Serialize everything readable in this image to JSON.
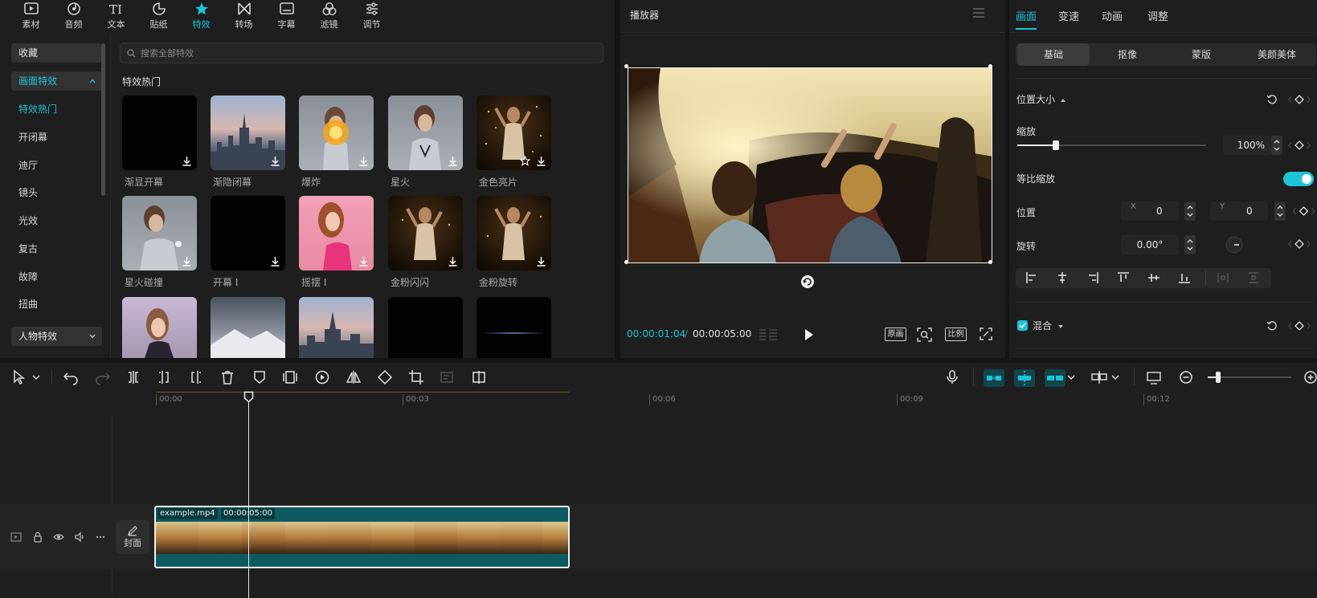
{
  "toolbar": {
    "tabs": [
      {
        "label": "素材",
        "icon": "media-icon",
        "active": false
      },
      {
        "label": "音频",
        "icon": "audio-icon",
        "active": false
      },
      {
        "label": "文本",
        "icon": "text-icon",
        "active": false
      },
      {
        "label": "贴纸",
        "icon": "sticker-icon",
        "active": false
      },
      {
        "label": "特效",
        "icon": "effects-star-icon",
        "active": true
      },
      {
        "label": "转场",
        "icon": "transition-icon",
        "active": false
      },
      {
        "label": "字幕",
        "icon": "subtitle-icon",
        "active": false
      },
      {
        "label": "滤镜",
        "icon": "filter-icon",
        "active": false
      },
      {
        "label": "调节",
        "icon": "adjust-icon",
        "active": false
      }
    ],
    "accent_color": "#1ec3d8"
  },
  "nav": {
    "favorites": "收藏",
    "group_screen": "画面特效",
    "items": [
      "特效热门",
      "开闭幕",
      "迪厅",
      "镜头",
      "光效",
      "复古",
      "故障",
      "扭曲"
    ],
    "active_item": "特效热门",
    "group_people": "人物特效"
  },
  "search": {
    "placeholder": "搜索全部特效"
  },
  "section_title": "特效热门",
  "effects": [
    {
      "label": "渐显开幕"
    },
    {
      "label": "渐隐闭幕"
    },
    {
      "label": "爆炸"
    },
    {
      "label": "星火"
    },
    {
      "label": "金色亮片"
    },
    {
      "label": "星火碰撞"
    },
    {
      "label": "开幕 I"
    },
    {
      "label": "摇摆 I"
    },
    {
      "label": "金粉闪闪"
    },
    {
      "label": "金粉旋转"
    }
  ],
  "player": {
    "title": "播放器",
    "time_current": "00:00:01:04",
    "time_separator": "/",
    "time_total": "00:00:05:00",
    "btn_original": "原画",
    "btn_ratio": "比例"
  },
  "properties": {
    "tabs": [
      "画面",
      "变速",
      "动画",
      "调整"
    ],
    "active_tab": "画面",
    "sub_tabs": [
      "基础",
      "抠像",
      "蒙版",
      "美颜美体"
    ],
    "active_sub_tab": "基础",
    "section_position_size": "位置大小",
    "scale_label": "缩放",
    "scale_value": "100%",
    "scale_level": 0.2,
    "uniform_scale_label": "等比缩放",
    "uniform_scale_on": true,
    "position_label": "位置",
    "pos_x_label": "X",
    "pos_x_value": "0",
    "pos_y_label": "Y",
    "pos_y_value": "0",
    "rotation_label": "旋转",
    "rotation_value": "0.00°",
    "blend_label": "混合",
    "blend_checked": true
  },
  "timeline": {
    "ruler_labels": [
      "00:00",
      "00:03",
      "00:06",
      "00:09",
      "00:12"
    ],
    "clip_name": "example.mp4",
    "clip_duration": "00:00:05:00",
    "cover_label": "封面"
  }
}
